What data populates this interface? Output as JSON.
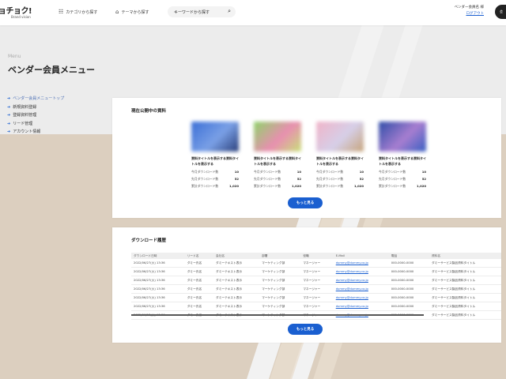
{
  "header": {
    "logo_main": "ョチョク!",
    "logo_sub": "Brand vision",
    "nav_category": "カテゴリから探す",
    "nav_theme": "テーマから探す",
    "search_placeholder": "キーワードから探す",
    "vendor_name": "ベンダー会員名 様",
    "logout": "ログアウト",
    "corner_label": "会"
  },
  "page": {
    "menu_en": "Menu",
    "title": "ベンダー会員メニュー"
  },
  "sidebar": {
    "items": [
      {
        "label": "ベンダー会員メニュートップ"
      },
      {
        "label": "新規資料登録"
      },
      {
        "label": "登録資料管理"
      },
      {
        "label": "リード管理"
      },
      {
        "label": "アカウント情報"
      }
    ]
  },
  "published": {
    "title": "現在公開中の資料",
    "more": "もっと見る",
    "stat_labels": [
      "今月ダウンロード数",
      "先月ダウンロード数",
      "累計ダウンロード数"
    ],
    "docs": [
      {
        "title": "資料タイトルを表示する資料タイトルを表示する",
        "stats": [
          "10",
          "52",
          "1,020"
        ],
        "colors": [
          "#3b6fd6",
          "#7aa0e6",
          "#2a3f7a"
        ]
      },
      {
        "title": "資料タイトルを表示する資料タイトルを表示する",
        "stats": [
          "10",
          "52",
          "1,020"
        ],
        "colors": [
          "#8fd36a",
          "#e88fb0",
          "#c9e07a"
        ]
      },
      {
        "title": "資料タイトルを表示する資料タイトルを表示する",
        "stats": [
          "10",
          "52",
          "1,020"
        ],
        "colors": [
          "#f0b4c8",
          "#d6cfe8",
          "#c7a57c"
        ]
      },
      {
        "title": "資料タイトルを表示する資料タイトルを表示する",
        "stats": [
          "10",
          "52",
          "1,020"
        ],
        "colors": [
          "#2f4ea8",
          "#a77ed0",
          "#385fc2"
        ]
      }
    ]
  },
  "history": {
    "title": "ダウンロード履歴",
    "more": "もっと見る",
    "columns": [
      "ダウンロード日時",
      "リード名",
      "会社名",
      "部署",
      "役職",
      "E-Mail",
      "電話",
      "資料名"
    ],
    "rows": [
      [
        "2022/06/27(火) 13:36",
        "ダミー氏名",
        "ダミーテキスト表示",
        "マーケティング部",
        "マネージャー",
        "dummy@dummy.co.jp",
        "000-0000-0000",
        "ダミーサービス製品資料タイトル"
      ],
      [
        "2022/06/27(火) 13:36",
        "ダミー氏名",
        "ダミーテキスト表示",
        "マーケティング部",
        "マネージャー",
        "dummy@dummy.co.jp",
        "000-0000-0000",
        "ダミーサービス製品資料タイトル"
      ],
      [
        "2022/06/27(火) 13:36",
        "ダミー氏名",
        "ダミーテキスト表示",
        "マーケティング部",
        "マネージャー",
        "dummy@dummy.co.jp",
        "000-0000-0000",
        "ダミーサービス製品資料タイトル"
      ],
      [
        "2022/06/27(火) 13:36",
        "ダミー氏名",
        "ダミーテキスト表示",
        "マーケティング部",
        "マネージャー",
        "dummy@dummy.co.jp",
        "000-0000-0000",
        "ダミーサービス製品資料タイトル"
      ],
      [
        "2022/06/27(火) 13:36",
        "ダミー氏名",
        "ダミーテキスト表示",
        "マーケティング部",
        "マネージャー",
        "dummy@dummy.co.jp",
        "000-0000-0000",
        "ダミーサービス製品資料タイトル"
      ],
      [
        "2022/06/27(火) 13:36",
        "ダミー氏名",
        "ダミーテキスト表示",
        "マーケティング部",
        "マネージャー",
        "dummy@dummy.co.jp",
        "000-0000-0000",
        "ダミーサービス製品資料タイトル"
      ],
      [
        "2022/06/27(火) 13:36",
        "ダミー氏名",
        "ダミーテキスト表示",
        "マーケティング部",
        "マネージャー",
        "dummy@dummy.co.jp",
        "000-0000-0000",
        "ダミーサービス製品資料タイトル"
      ]
    ]
  },
  "icons": {
    "category": "grid-icon",
    "theme": "tag-icon",
    "search": "search-icon",
    "sidebar_arrow": "arrow-right-icon"
  },
  "colors": {
    "accent": "#1a5fd0",
    "background": "#dccfbf"
  }
}
